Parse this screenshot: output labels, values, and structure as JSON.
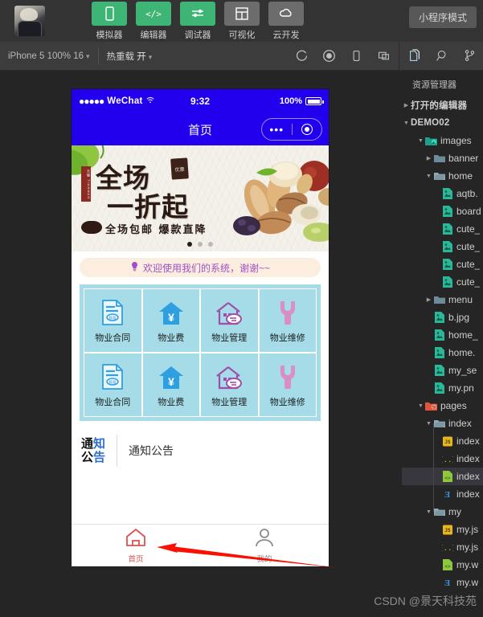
{
  "topbar": {
    "avatar_alt": "user-avatar",
    "buttons": [
      {
        "label": "模拟器",
        "icon": "phone-icon",
        "style": "green"
      },
      {
        "label": "编辑器",
        "icon": "code-icon",
        "style": "green"
      },
      {
        "label": "调试器",
        "icon": "sliders-icon",
        "style": "green"
      },
      {
        "label": "可视化",
        "icon": "layout-icon",
        "style": "grey"
      },
      {
        "label": "云开发",
        "icon": "cloud-icon",
        "style": "grey"
      }
    ],
    "mode_badge": "小程序模式"
  },
  "subbar": {
    "device": "iPhone 5 100% 16",
    "caret": "▾",
    "hotreload_label": "热重载",
    "hotreload_value": "开",
    "icons": [
      "refresh-icon",
      "record-icon",
      "preview-phone-icon",
      "remote-debug-icon",
      "explorer-files-icon",
      "search-icon",
      "source-control-icon"
    ]
  },
  "simulator": {
    "status": {
      "signal_dots": "●●●●●",
      "carrier": "WeChat",
      "wifi": "⌃",
      "time": "9:32",
      "battery_text": "100%"
    },
    "nav": {
      "title": "首页",
      "capsule_dots": "•••"
    },
    "banner": {
      "line1": "全场",
      "line2": "一折起",
      "seal": "优惠",
      "stamp": "天猫 TIANMAO",
      "subtitle": "全场包邮 爆款直降",
      "dots": 3,
      "active_dot": 0
    },
    "notice_strip": {
      "icon": "lightbulb-icon",
      "text": "欢迎使用我们的系统，谢谢~~"
    },
    "grid": {
      "rows": [
        [
          {
            "label": "物业合同",
            "icon": "contract-icon",
            "color": "#2e9fe0"
          },
          {
            "label": "物业费",
            "icon": "house-yen-icon",
            "color": "#2e9fe0"
          },
          {
            "label": "物业管理",
            "icon": "house-chat-icon",
            "color": "#a04fa8"
          },
          {
            "label": "物业维修",
            "icon": "wrench-icon",
            "color": "#d98fc0"
          }
        ],
        [
          {
            "label": "物业合同",
            "icon": "contract-icon",
            "color": "#2e9fe0"
          },
          {
            "label": "物业费",
            "icon": "house-yen-icon",
            "color": "#2e9fe0"
          },
          {
            "label": "物业管理",
            "icon": "house-chat-icon",
            "color": "#a04fa8"
          },
          {
            "label": "物业维修",
            "icon": "wrench-icon",
            "color": "#d98fc0"
          }
        ]
      ]
    },
    "notice_block": {
      "logo_line1_a": "通",
      "logo_line1_b": "知",
      "logo_line2_a": "公",
      "logo_line2_b": "告",
      "title": "通知公告"
    },
    "tabbar": [
      {
        "label": "首页",
        "icon": "home-icon",
        "active": true
      },
      {
        "label": "我的",
        "icon": "person-icon",
        "active": false
      }
    ],
    "annotation": {
      "type": "red-arrow",
      "direction": "left"
    }
  },
  "explorer": {
    "title": "资源管理器",
    "open_editors": "打开的编辑器",
    "project": "DEMO02",
    "tree": [
      {
        "name": "images",
        "type": "folder-images",
        "depth": 1,
        "tw": "▾"
      },
      {
        "name": "banner",
        "type": "folder",
        "depth": 2,
        "tw": "▸"
      },
      {
        "name": "home",
        "type": "folder-open",
        "depth": 2,
        "tw": "▾"
      },
      {
        "name": "aqtb.",
        "type": "image",
        "depth": 3,
        "tw": ""
      },
      {
        "name": "board",
        "type": "image",
        "depth": 3,
        "tw": ""
      },
      {
        "name": "cute_",
        "type": "image",
        "depth": 3,
        "tw": ""
      },
      {
        "name": "cute_",
        "type": "image",
        "depth": 3,
        "tw": ""
      },
      {
        "name": "cute_",
        "type": "image",
        "depth": 3,
        "tw": ""
      },
      {
        "name": "cute_",
        "type": "image",
        "depth": 3,
        "tw": ""
      },
      {
        "name": "menu",
        "type": "folder",
        "depth": 2,
        "tw": "▸"
      },
      {
        "name": "b.jpg",
        "type": "image",
        "depth": 2,
        "tw": ""
      },
      {
        "name": "home_",
        "type": "image",
        "depth": 2,
        "tw": ""
      },
      {
        "name": "home.",
        "type": "image",
        "depth": 2,
        "tw": ""
      },
      {
        "name": "my_se",
        "type": "image",
        "depth": 2,
        "tw": ""
      },
      {
        "name": "my.pn",
        "type": "image",
        "depth": 2,
        "tw": ""
      },
      {
        "name": "pages",
        "type": "folder-pages",
        "depth": 1,
        "tw": "▾"
      },
      {
        "name": "index",
        "type": "folder-open",
        "depth": 2,
        "tw": "▾"
      },
      {
        "name": "index",
        "type": "js",
        "depth": 3,
        "tw": ""
      },
      {
        "name": "index",
        "type": "json",
        "depth": 3,
        "tw": ""
      },
      {
        "name": "index",
        "type": "wxml",
        "depth": 3,
        "tw": "",
        "selected": true
      },
      {
        "name": "index",
        "type": "wxss",
        "depth": 3,
        "tw": ""
      },
      {
        "name": "my",
        "type": "folder-open",
        "depth": 2,
        "tw": "▾"
      },
      {
        "name": "my.js",
        "type": "js",
        "depth": 3,
        "tw": ""
      },
      {
        "name": "my.js",
        "type": "json",
        "depth": 3,
        "tw": ""
      },
      {
        "name": "my.w",
        "type": "wxml",
        "depth": 3,
        "tw": ""
      },
      {
        "name": "my.w",
        "type": "wxss",
        "depth": 3,
        "tw": ""
      }
    ]
  },
  "watermark": "CSDN @景天科技苑",
  "colors": {
    "accent_green": "#3eb575",
    "wechat_blue": "#2200ee",
    "grid_bg": "#a5dce8",
    "notice_bg": "#fceede",
    "notice_text": "#a14fc8",
    "arrow_red": "#fa0f00",
    "tab_active": "#d9534f"
  }
}
